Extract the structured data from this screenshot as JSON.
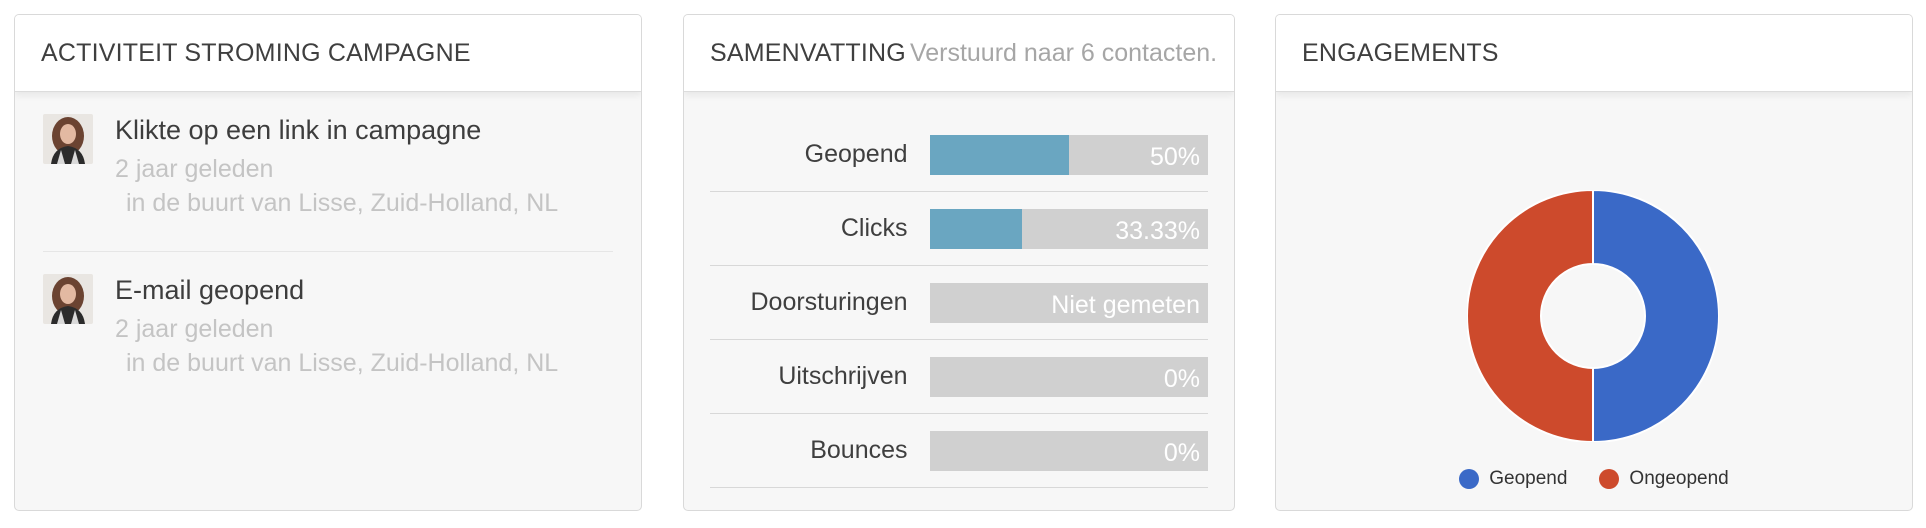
{
  "activity": {
    "title": "ACTIVITEIT STROMING CAMPAGNE",
    "items": [
      {
        "title": "Klikte op een link in campagne",
        "time": "2 jaar geleden",
        "location": "in de buurt van Lisse, Zuid-Holland, NL"
      },
      {
        "title": "E-mail geopend",
        "time": "2 jaar geleden",
        "location": "in de buurt van Lisse, Zuid-Holland, NL"
      }
    ]
  },
  "summary": {
    "title": "SAMENVATTING",
    "subtitle": "Verstuurd naar 6 contacten.",
    "rows": [
      {
        "label": "Geopend",
        "value": "50%",
        "fill": 0.5
      },
      {
        "label": "Clicks",
        "value": "33.33%",
        "fill": 0.3333
      },
      {
        "label": "Doorsturingen",
        "value": "Niet gemeten",
        "fill": 0
      },
      {
        "label": "Uitschrijven",
        "value": "0%",
        "fill": 0
      },
      {
        "label": "Bounces",
        "value": "0%",
        "fill": 0
      }
    ],
    "bar_color": "#6aa6c1",
    "track_color": "#d0d0d0"
  },
  "engagements": {
    "title": "ENGAGEMENTS",
    "chart_data": {
      "type": "pie",
      "categories": [
        "Geopend",
        "Ongeopend"
      ],
      "values": [
        50,
        50
      ],
      "colors": [
        "#3a69c7",
        "#cd4a2c"
      ],
      "legend_position": "bottom"
    }
  }
}
